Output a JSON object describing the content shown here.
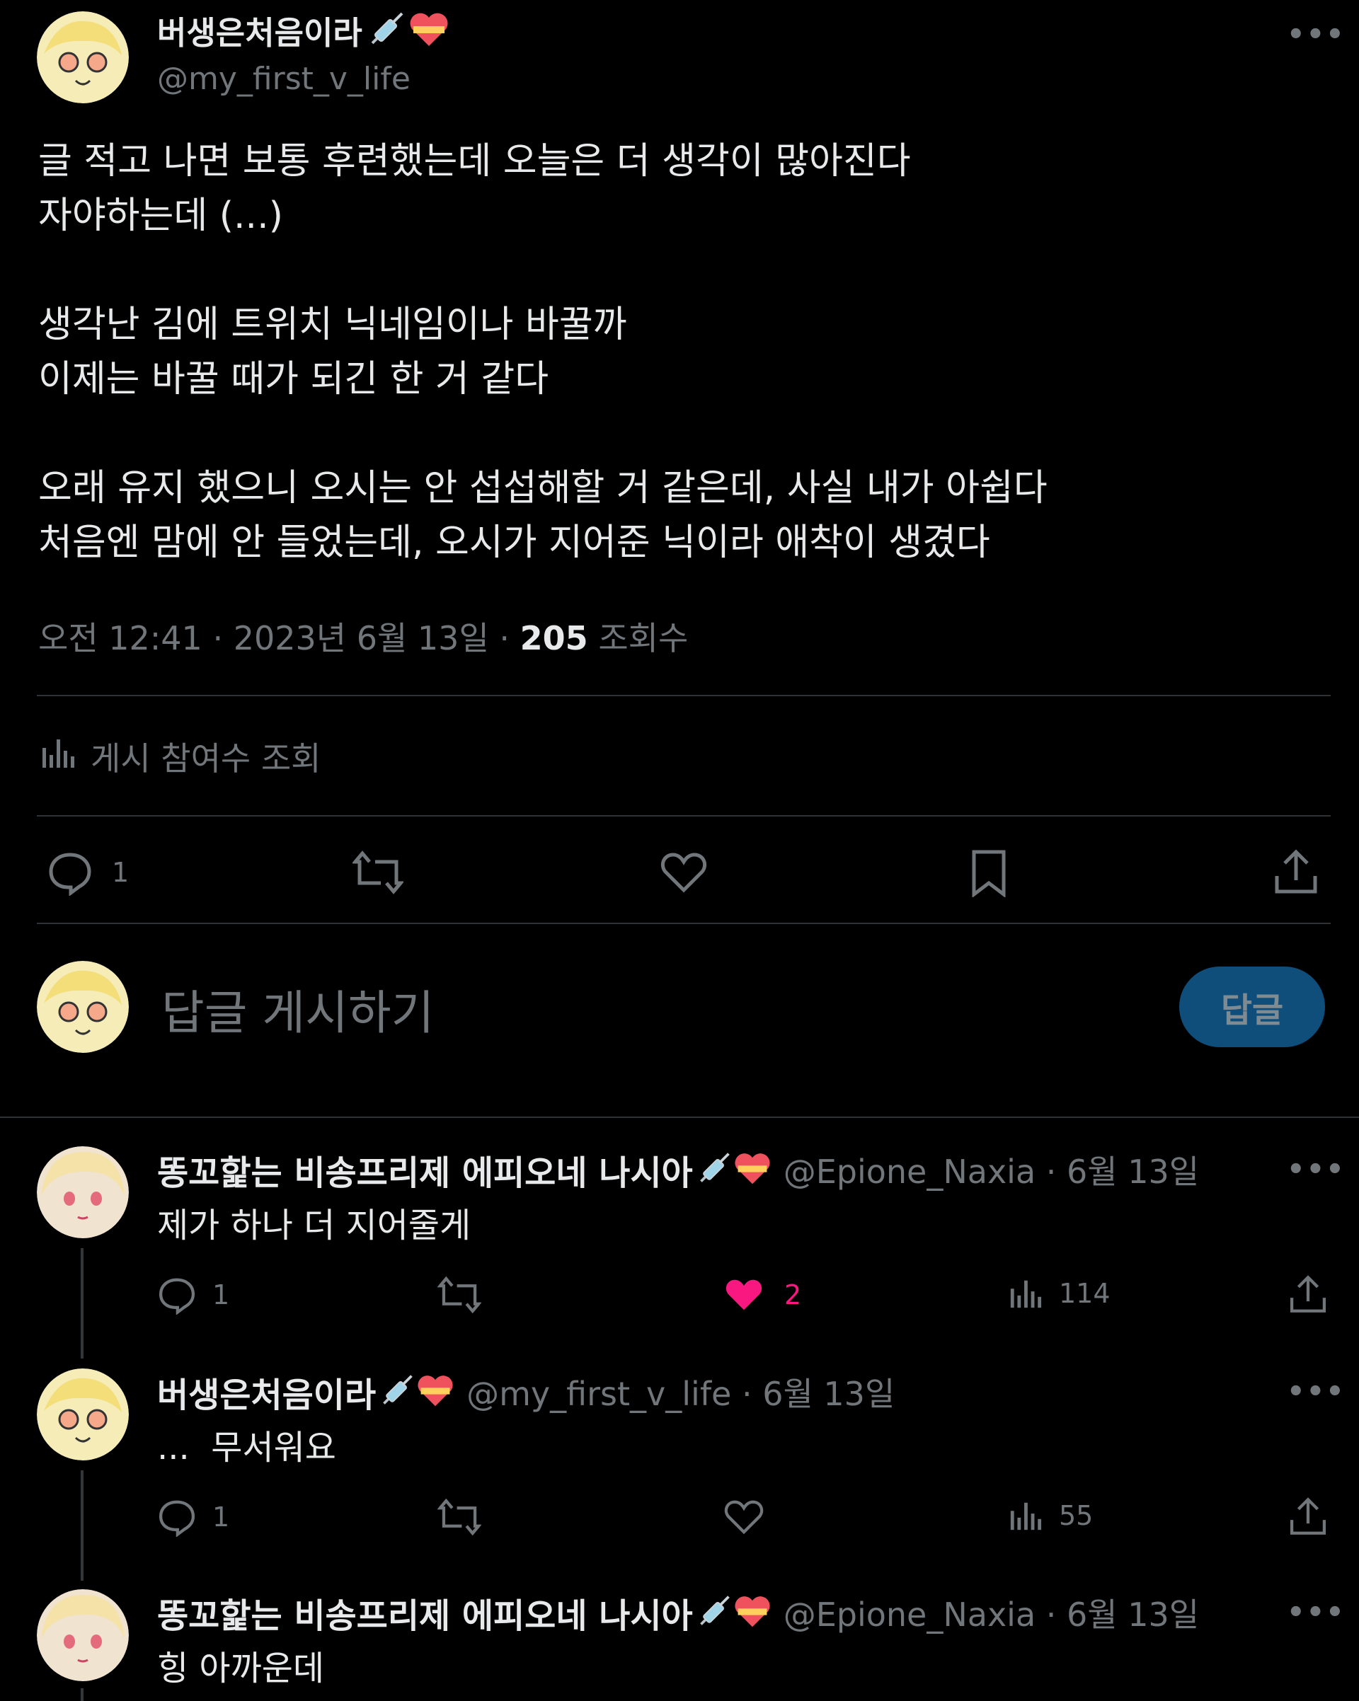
{
  "main_post": {
    "author_name": "버생은처음이라",
    "handle": "@my_first_v_life",
    "text_lines": [
      "글 적고 나면 보통 후련했는데 오늘은 더 생각이 많아진다",
      "자야하는데 (...)",
      "",
      "생각난 김에 트위치 닉네임이나 바꿀까",
      "이제는 바꿀 때가 되긴 한 거 같다",
      "",
      "오래 유지 했으니 오시는 안 섭섭해할 거 같은데, 사실 내가 아쉽다",
      "처음엔 맘에 안 들었는데, 오시가 지어준 닉이라 애착이 생겼다"
    ],
    "time": "오전 12:41",
    "date": "2023년 6월 13일",
    "views_count": "205",
    "views_label": "조회수",
    "engagement_label": "게시 참여수 조회",
    "reply_count": "1"
  },
  "composer": {
    "placeholder": "답글 게시하기",
    "button_label": "답글"
  },
  "replies": [
    {
      "author_name": "똥꼬핥는 비송프리제 에피오네 나시아",
      "handle": "@Epione_Naxia",
      "date": "6월 13일",
      "text": "제가 하나 더 지어줄게",
      "reply_count": "1",
      "like_count": "2",
      "liked": true,
      "views": "114"
    },
    {
      "author_name": "버생은처음이라",
      "handle": "@my_first_v_life",
      "date": "6월 13일",
      "text": "...  무서워요",
      "reply_count": "1",
      "like_count": "",
      "liked": false,
      "views": "55"
    },
    {
      "author_name": "똥꼬핥는 비송프리제 에피오네 나시아",
      "handle": "@Epione_Naxia",
      "date": "6월 13일",
      "text": "힝 아까운데"
    }
  ],
  "colors": {
    "background": "#000000",
    "text": "#e7e9ea",
    "muted": "#71767b",
    "divider": "#2f3336",
    "reply_button": "#0f4e7a",
    "like_active": "#f91880"
  },
  "icons": [
    "syringe-icon",
    "heart-badge-icon",
    "more-icon",
    "analytics-icon",
    "reply-icon",
    "retweet-icon",
    "like-icon",
    "bookmark-icon",
    "share-icon"
  ]
}
